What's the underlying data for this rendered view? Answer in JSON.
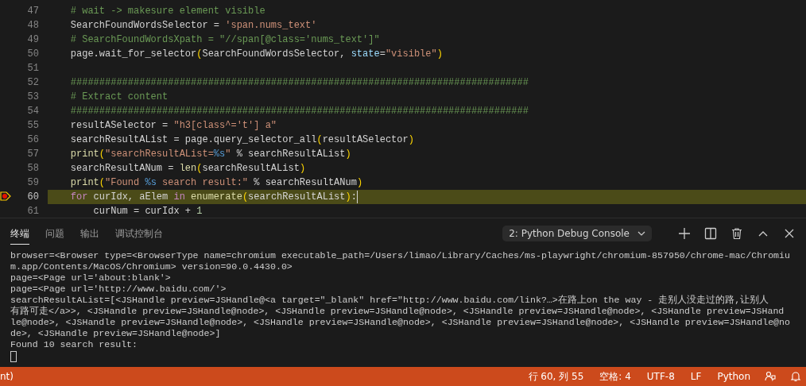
{
  "editor": {
    "lines": [
      {
        "number": "47",
        "current": false,
        "breakpoint": false,
        "tokens": [
          {
            "kind": "comment",
            "text": "    # wait -> makesure element visible"
          }
        ]
      },
      {
        "number": "48",
        "current": false,
        "breakpoint": false,
        "tokens": [
          {
            "kind": "plain",
            "text": "    SearchFoundWordsSelector = "
          },
          {
            "kind": "string",
            "text": "'span.nums_text'"
          }
        ]
      },
      {
        "number": "49",
        "current": false,
        "breakpoint": false,
        "tokens": [
          {
            "kind": "comment",
            "text": "    # SearchFoundWordsXpath = \"//span[@class='nums_text']\""
          }
        ]
      },
      {
        "number": "50",
        "current": false,
        "breakpoint": false,
        "tokens": [
          {
            "kind": "plain",
            "text": "    page.wait_for_selector"
          },
          {
            "kind": "bracket",
            "text": "("
          },
          {
            "kind": "plain",
            "text": "SearchFoundWordsSelector, "
          },
          {
            "kind": "param",
            "text": "state"
          },
          {
            "kind": "plain",
            "text": "="
          },
          {
            "kind": "string",
            "text": "\"visible\""
          },
          {
            "kind": "bracket",
            "text": ")"
          }
        ]
      },
      {
        "number": "51",
        "current": false,
        "breakpoint": false
      },
      {
        "number": "52",
        "current": false,
        "breakpoint": false,
        "tokens": [
          {
            "kind": "comment",
            "text": "    ################################################################################"
          }
        ]
      },
      {
        "number": "53",
        "current": false,
        "breakpoint": false,
        "tokens": [
          {
            "kind": "comment",
            "text": "    # Extract content"
          }
        ]
      },
      {
        "number": "54",
        "current": false,
        "breakpoint": false,
        "tokens": [
          {
            "kind": "comment",
            "text": "    ################################################################################"
          }
        ]
      },
      {
        "number": "55",
        "current": false,
        "breakpoint": false,
        "tokens": [
          {
            "kind": "plain",
            "text": "    resultASelector = "
          },
          {
            "kind": "string",
            "text": "\"h3[class^='t'] a\""
          }
        ]
      },
      {
        "number": "56",
        "current": false,
        "breakpoint": false,
        "tokens": [
          {
            "kind": "plain",
            "text": "    searchResultAList = page.query_selector_all"
          },
          {
            "kind": "bracket",
            "text": "("
          },
          {
            "kind": "plain",
            "text": "resultASelector"
          },
          {
            "kind": "bracket",
            "text": ")"
          }
        ]
      },
      {
        "number": "57",
        "current": false,
        "breakpoint": false,
        "tokens": [
          {
            "kind": "func",
            "text": "    print"
          },
          {
            "kind": "bracket",
            "text": "("
          },
          {
            "kind": "string",
            "text": "\"searchResultAList="
          },
          {
            "kind": "format",
            "text": "%s"
          },
          {
            "kind": "string",
            "text": "\""
          },
          {
            "kind": "plain",
            "text": " % searchResultAList"
          },
          {
            "kind": "bracket",
            "text": ")"
          }
        ]
      },
      {
        "number": "58",
        "current": false,
        "breakpoint": false,
        "tokens": [
          {
            "kind": "plain",
            "text": "    searchResultANum = "
          },
          {
            "kind": "func",
            "text": "len"
          },
          {
            "kind": "bracket",
            "text": "("
          },
          {
            "kind": "plain",
            "text": "searchResultAList"
          },
          {
            "kind": "bracket",
            "text": ")"
          }
        ]
      },
      {
        "number": "59",
        "current": false,
        "breakpoint": false,
        "tokens": [
          {
            "kind": "func",
            "text": "    print"
          },
          {
            "kind": "bracket",
            "text": "("
          },
          {
            "kind": "string",
            "text": "\"Found "
          },
          {
            "kind": "format",
            "text": "%s"
          },
          {
            "kind": "string",
            "text": " search result:\""
          },
          {
            "kind": "plain",
            "text": " % searchResultANum"
          },
          {
            "kind": "bracket",
            "text": ")"
          }
        ]
      },
      {
        "number": "60",
        "current": true,
        "breakpoint": true,
        "tokens": [
          {
            "kind": "keyword",
            "text": "    for"
          },
          {
            "kind": "plain",
            "text": " curIdx, aElem "
          },
          {
            "kind": "keyword",
            "text": "in"
          },
          {
            "kind": "func",
            "text": " enumerate"
          },
          {
            "kind": "bracket",
            "text": "("
          },
          {
            "kind": "plain",
            "text": "searchResultAList"
          },
          {
            "kind": "bracket",
            "text": ")"
          },
          {
            "kind": "plain",
            "text": ":"
          }
        ]
      },
      {
        "number": "61",
        "current": false,
        "breakpoint": false,
        "tokens": [
          {
            "kind": "plain",
            "text": "        curNum = curIdx + "
          },
          {
            "kind": "number",
            "text": "1"
          }
        ]
      }
    ]
  },
  "panel": {
    "tabs": [
      {
        "label": "终端",
        "selected": true
      },
      {
        "label": "问题",
        "selected": false
      },
      {
        "label": "输出",
        "selected": false
      },
      {
        "label": "调试控制台",
        "selected": false
      }
    ],
    "terminal_select": "2: Python Debug Console",
    "terminal_lines": [
      "browser=<Browser type=<BrowserType name=chromium executable_path=/Users/limao/Library/Caches/ms-playwright/chromium-857950/chrome-mac/Chromiu",
      "m.app/Contents/MacOS/Chromium> version=90.0.4430.0>",
      "page=<Page url='about:blank'>",
      "page=<Page url='http://www.baidu.com/'>",
      "searchResultAList=[<JSHandle preview=JSHandle@<a target=\"_blank\" href=\"http://www.baidu.com/link?…>在路上on the way - 走别人没走过的路,让别人",
      "有路可走</a>>, <JSHandle preview=JSHandle@node>, <JSHandle preview=JSHandle@node>, <JSHandle preview=JSHandle@node>, <JSHandle preview=JSHand",
      "le@node>, <JSHandle preview=JSHandle@node>, <JSHandle preview=JSHandle@node>, <JSHandle preview=JSHandle@node>, <JSHandle preview=JSHandle@no",
      "de>, <JSHandle preview=JSHandle@node>]",
      "Found 10 search result:"
    ]
  },
  "status_bar": {
    "left": "nt)",
    "items": [
      "行 60, 列 55",
      "空格: 4",
      "UTF-8",
      "LF",
      "Python"
    ]
  }
}
